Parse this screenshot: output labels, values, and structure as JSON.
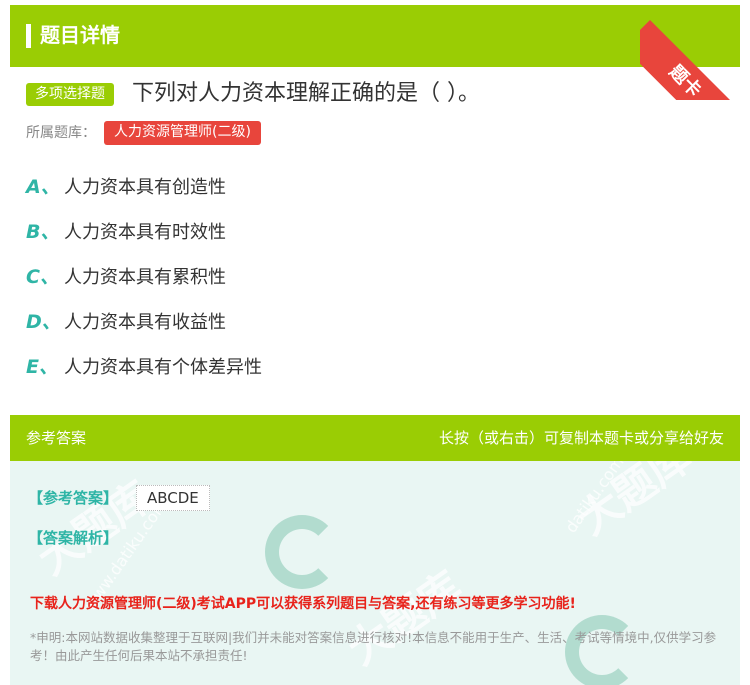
{
  "header": {
    "title": "题目详情",
    "ribbon_label": "题卡"
  },
  "question": {
    "type_badge": "多项选择题",
    "title": "下列对人力资本理解正确的是（ ）。",
    "bank_label": "所属题库：",
    "bank_name": "人力资源管理师(二级)"
  },
  "options": [
    {
      "letter": "A、",
      "text": "人力资本具有创造性"
    },
    {
      "letter": "B、",
      "text": "人力资本具有时效性"
    },
    {
      "letter": "C、",
      "text": "人力资本具有累积性"
    },
    {
      "letter": "D、",
      "text": "人力资本具有收益性"
    },
    {
      "letter": "E、",
      "text": "人力资本具有个体差异性"
    }
  ],
  "answer": {
    "header_title": "参考答案",
    "header_hint": "长按（或右击）可复制本题卡或分享给好友",
    "ref_label": "【参考答案】",
    "ref_value": "ABCDE",
    "analysis_label": "【答案解析】",
    "promo": "下载人力资源管理师(二级)考试APP可以获得系列题目与答案,还有练习等更多学习功能!",
    "disclaimer": "*申明:本网站数据收集整理于互联网|我们并未能对答案信息进行核对!本信息不能用于生产、生活、考试等情境中,仅供学习参考！由此产生任何后果本站不承担责任!"
  },
  "colors": {
    "brand_green": "#9acd04",
    "accent_red": "#e8453c",
    "option_teal": "#2fb5a6",
    "promo_red": "#e8231b"
  }
}
